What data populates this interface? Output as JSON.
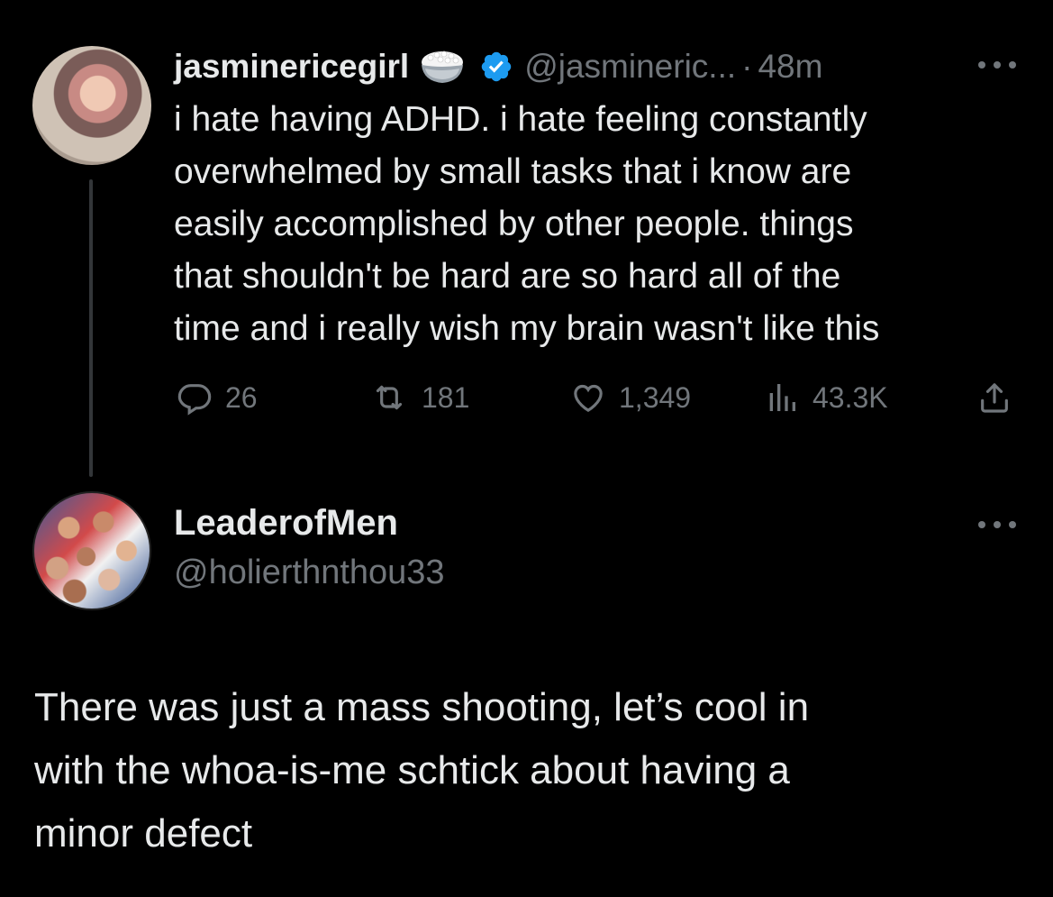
{
  "original_tweet": {
    "display_name": "jasminericegirl",
    "name_emoji": "rice-bowl-emoji",
    "verified": true,
    "handle": "@jasmineric...",
    "separator": "·",
    "time": "48m",
    "text": "i hate having ADHD. i hate feeling constantly\noverwhelmed by small tasks that i know are\neasily accomplished by other people. things\nthat shouldn't be hard are so hard all of the\ntime and i really wish my brain wasn't like this",
    "actions": {
      "replies": "26",
      "retweets": "181",
      "likes": "1,349",
      "views": "43.3K"
    }
  },
  "reply": {
    "display_name": "LeaderofMen",
    "handle": "@holierthnthou33",
    "text": "There was just a mass shooting, let’s cool in\nwith the whoa-is-me schtick about having a\nminor defect"
  },
  "colors": {
    "background": "#000000",
    "primary_text": "#e7e9ea",
    "secondary_text": "#71767b",
    "verified_blue": "#1d9bf0",
    "thread_line": "#333639"
  },
  "icons": [
    "more-icon",
    "verified-icon",
    "reply-icon",
    "retweet-icon",
    "like-icon",
    "views-icon",
    "share-icon"
  ]
}
